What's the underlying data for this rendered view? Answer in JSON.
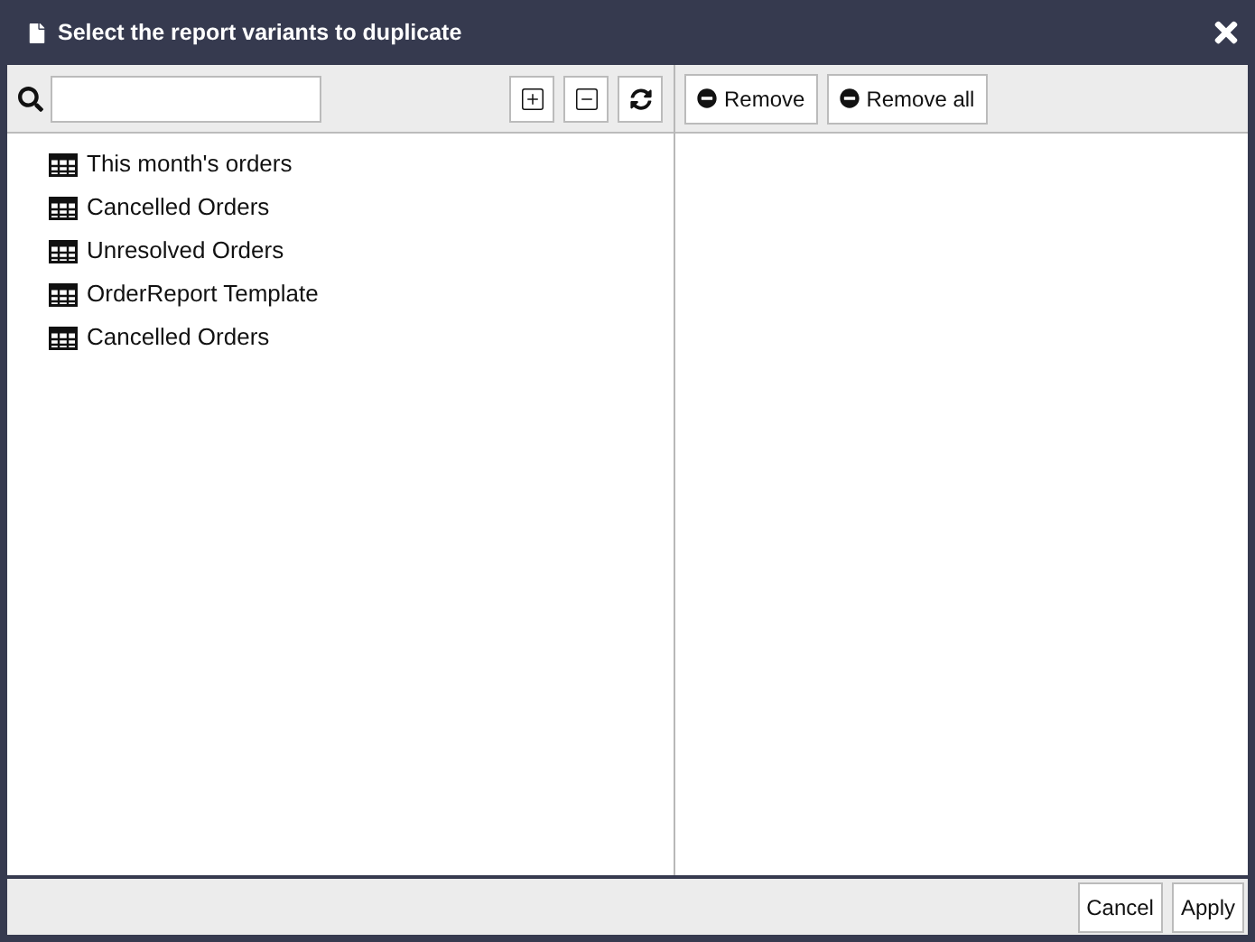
{
  "window": {
    "title": "Select the report variants to duplicate"
  },
  "tree_buttons": [
    {
      "kind": "expand"
    },
    {
      "kind": "collapse"
    },
    {
      "kind": "refresh"
    }
  ],
  "items": [
    {
      "label": "This month's orders"
    },
    {
      "label": "Cancelled Orders"
    },
    {
      "label": "Unresolved Orders"
    },
    {
      "label": "OrderReport Template"
    },
    {
      "label": "Cancelled Orders"
    }
  ],
  "right_buttons": [
    "Remove",
    "Remove all"
  ],
  "footer_buttons": [
    "Cancel",
    "Apply"
  ]
}
